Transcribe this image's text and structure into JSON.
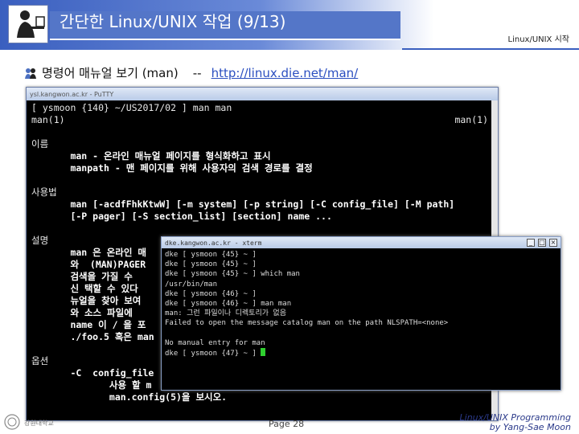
{
  "slide": {
    "title": "간단한 Linux/UNIX 작업 (9/13)",
    "course_label": "Linux/UNIX 시작",
    "bullet_text": "명령어 매뉴얼 보기 (man)",
    "bullet_sep": "--",
    "bullet_link": "http://linux.die.net/man/"
  },
  "putty": {
    "title": "ysl.kangwon.ac.kr - PuTTY",
    "lines": [
      "[ ysmoon {140} ~/US2017/02 ] man man",
      "man(1)",
      "",
      "이름",
      "       man - 온라인 매뉴얼 페이지를 형식화하고 표시",
      "       manpath - 맨 페이지를 위해 사용자의 검색 경로를 결정",
      "",
      "사용법",
      "       man [-acdfFhkKtwW] [-m system] [-p string] [-C config_file] [-M path]",
      "       [-P pager] [-S section_list] [section] name ...",
      "",
      "설명",
      "       man 은 온라인 매",
      "       와  (MAN)PAGER",
      "       검색을 가질 수",
      "       신 택할 수 있다",
      "       뉴얼을 찾아 보여",
      "       와 소스 파일에",
      "       name 이 / 을 포",
      "       ./foo.5 혹은 man",
      "",
      "옵션",
      "       -C  config_file",
      "              사용 할 m",
      "              man.config(5)을 보시오."
    ],
    "right_label": "man(1)"
  },
  "xterm": {
    "title": "dke.kangwon.ac.kr - xterm",
    "lines": [
      "dke [ ysmoon {45} ~ ]",
      "dke [ ysmoon {45} ~ ]",
      "dke [ ysmoon {45} ~ ] which man",
      "/usr/bin/man",
      "dke [ ysmoon {46} ~ ]",
      "dke [ ysmoon {46} ~ ] man man",
      "man: 그런 파일이나 디렉토리가 없음",
      "Failed to open the message catalog man on the path NLSPATH=<none>",
      "",
      "No manual entry for man",
      "dke [ ysmoon {47} ~ ] "
    ],
    "buttons": [
      "_",
      "□",
      "×"
    ]
  },
  "footer": {
    "university": "강원대학교",
    "page": "Page 28",
    "course_line1": "Linux/UNIX Programming",
    "course_line2": "by Yang-Sae Moon"
  }
}
